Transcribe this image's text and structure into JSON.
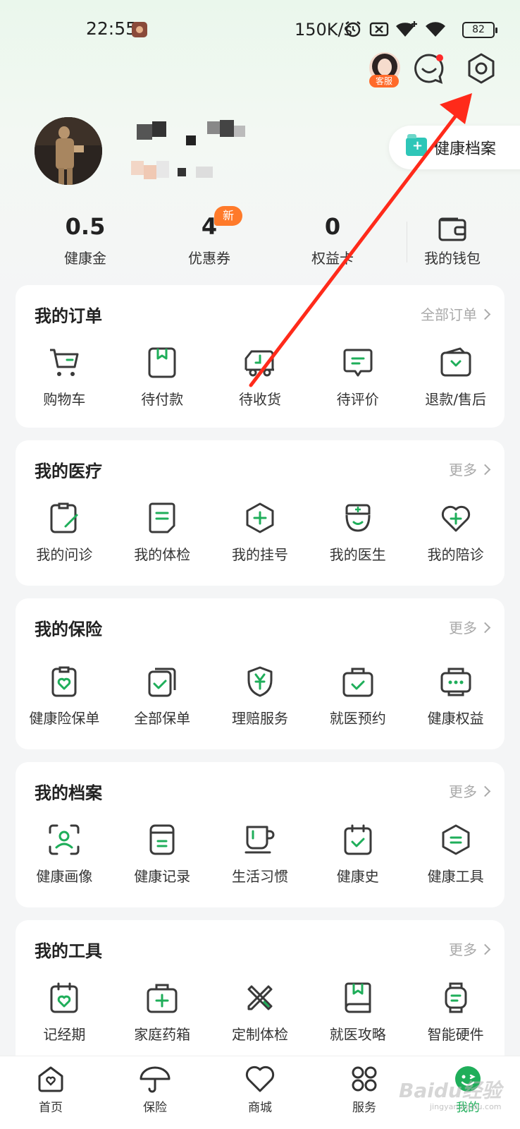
{
  "status_bar": {
    "time": "22:55",
    "net_speed": "150K/s",
    "battery": "82"
  },
  "header": {
    "customer_service_badge": "客服",
    "health_archive_button": "健康档案"
  },
  "stats": [
    {
      "value": "0.5",
      "label": "健康金"
    },
    {
      "value": "4",
      "label": "优惠券",
      "badge": "新"
    },
    {
      "value": "0",
      "label": "权益卡"
    }
  ],
  "wallet": {
    "label": "我的钱包"
  },
  "orders": {
    "title": "我的订单",
    "more": "全部订单",
    "items": [
      {
        "label": "购物车",
        "icon": "cart-icon"
      },
      {
        "label": "待付款",
        "icon": "wallet-card-icon"
      },
      {
        "label": "待收货",
        "icon": "truck-icon"
      },
      {
        "label": "待评价",
        "icon": "comment-icon"
      },
      {
        "label": "退款/售后",
        "icon": "refund-icon"
      }
    ]
  },
  "medical": {
    "title": "我的医疗",
    "more": "更多",
    "items": [
      {
        "label": "我的问诊",
        "icon": "consult-icon"
      },
      {
        "label": "我的体检",
        "icon": "checkup-icon"
      },
      {
        "label": "我的挂号",
        "icon": "register-icon"
      },
      {
        "label": "我的医生",
        "icon": "doctor-icon"
      },
      {
        "label": "我的陪诊",
        "icon": "heart-plus-icon"
      }
    ]
  },
  "insurance": {
    "title": "我的保险",
    "more": "更多",
    "items": [
      {
        "label": "健康险保单",
        "icon": "policy-icon"
      },
      {
        "label": "全部保单",
        "icon": "all-policies-icon"
      },
      {
        "label": "理赔服务",
        "icon": "claim-shield-icon"
      },
      {
        "label": "就医预约",
        "icon": "appointment-icon"
      },
      {
        "label": "健康权益",
        "icon": "rights-icon"
      }
    ]
  },
  "archive": {
    "title": "我的档案",
    "more": "更多",
    "items": [
      {
        "label": "健康画像",
        "icon": "portrait-icon"
      },
      {
        "label": "健康记录",
        "icon": "record-icon"
      },
      {
        "label": "生活习惯",
        "icon": "cup-icon"
      },
      {
        "label": "健康史",
        "icon": "history-icon"
      },
      {
        "label": "健康工具",
        "icon": "tools-icon"
      }
    ]
  },
  "tools": {
    "title": "我的工具",
    "more": "更多",
    "items": [
      {
        "label": "记经期",
        "icon": "calendar-heart-icon"
      },
      {
        "label": "家庭药箱",
        "icon": "medkit-icon"
      },
      {
        "label": "定制体检",
        "icon": "pencil-ruler-icon"
      },
      {
        "label": "就医攻略",
        "icon": "book-icon"
      },
      {
        "label": "智能硬件",
        "icon": "smartwatch-icon"
      }
    ]
  },
  "tabbar": [
    {
      "label": "首页",
      "icon": "home-icon"
    },
    {
      "label": "保险",
      "icon": "umbrella-icon"
    },
    {
      "label": "商城",
      "icon": "heart-icon"
    },
    {
      "label": "服务",
      "icon": "grid-icon"
    },
    {
      "label": "我的",
      "icon": "profile-active-icon"
    }
  ],
  "watermark": {
    "text": "Baidu经验",
    "sub": "jingyan.baidu.com"
  },
  "colors": {
    "accent": "#1fae5a",
    "icon_stroke": "#3a3a3a",
    "badge": "#ff6a2a",
    "annotation_arrow": "#ff2a1a"
  }
}
